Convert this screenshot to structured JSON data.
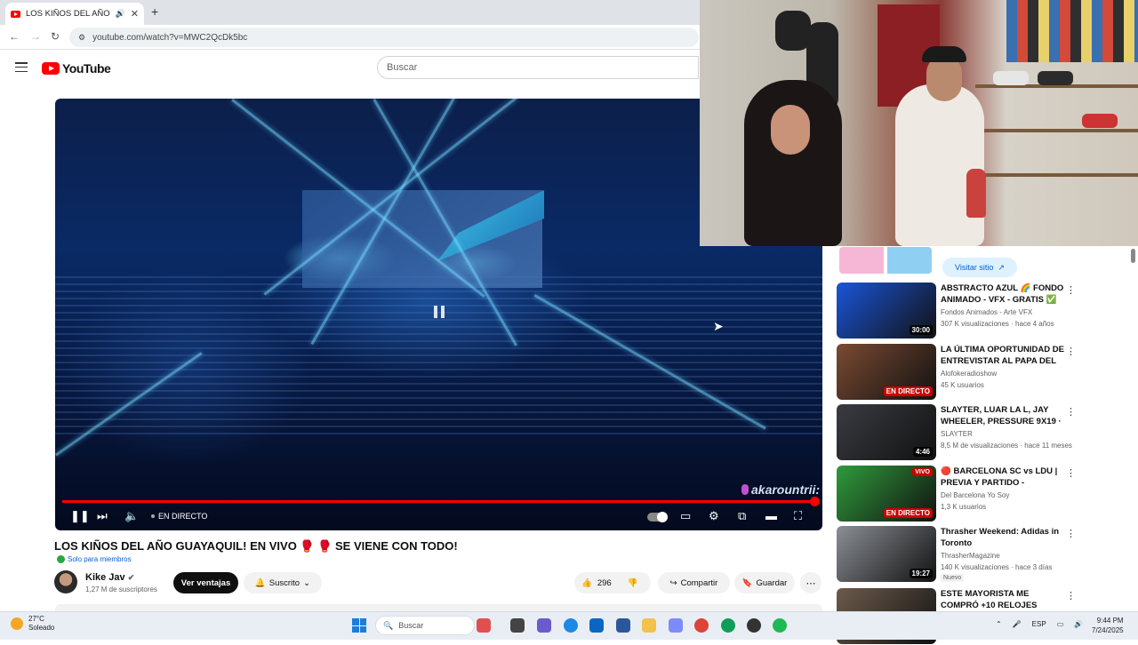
{
  "browser": {
    "tab_title": "LOS KIÑOS DEL AÑO GUAYAQUIL",
    "url": "youtube.com/watch?v=MWC2QcDk5bc"
  },
  "header": {
    "logo_text": "YouTube",
    "search_placeholder": "Buscar"
  },
  "player": {
    "live_label": "EN DIRECTO",
    "watermark_text": "akarountrii:",
    "progress": 1.0
  },
  "video": {
    "title": "LOS KIÑOS DEL AÑO GUAYAQUIL! EN VIVO 🥊 🥊 SE VIENE CON TODO!",
    "members_label": "Solo para miembros",
    "channel_name": "Kike Jav",
    "subscribers": "1,27 M de suscriptores",
    "ventajas_label": "Ver ventajas",
    "subscribed_label": "Suscrito",
    "likes": "296",
    "share_label": "Compartir",
    "save_label": "Guardar"
  },
  "sidebar": {
    "ad_button": "Visitar sitio",
    "recommendations": [
      {
        "title": "ABSTRACTO AZUL 🌈 FONDO ANIMADO - VFX - GRATIS ✅ ...",
        "channel": "Fondos Animados - Arte VFX",
        "meta": "307 K visualizaciones · hace 4 años",
        "badge": "30:00",
        "thumb_color": "#1a55d8"
      },
      {
        "title": "LA ÚLTIMA OPORTUNIDAD DE ENTREVISTAR AL PAPA DEL ...",
        "channel": "Alofokeradioshow",
        "meta": "45 K usuarios",
        "badge": "EN DIRECTO",
        "thumb_color": "#7a4a32"
      },
      {
        "title": "SLAYTER, LUAR LA L, JAY WHEELER, PRESSURE 9X19 · ...",
        "channel": "SLAYTER",
        "meta": "8,5 M de visualizaciones · hace 11 meses",
        "badge": "4:46",
        "thumb_color": "#3a3c42"
      },
      {
        "title": "🔴 BARCELONA SC vs LDU | PREVIA Y PARTIDO - LIGAPRO...",
        "channel": "Del Barcelona Yo Soy",
        "meta": "1,3 K usuarios",
        "badge": "EN DIRECTO",
        "top_badge": "VIVO",
        "thumb_color": "#2f9b3c"
      },
      {
        "title": "Thrasher Weekend: Adidas in Toronto",
        "channel": "ThrasherMagazine",
        "meta": "140 K visualizaciones · hace 3 días",
        "badge": "19:27",
        "new_tag": "Nuevo",
        "thumb_color": "#8b8f95"
      },
      {
        "title": "ESTE MAYORISTA ME COMPRÓ +10 RELOJES",
        "channel": "",
        "meta": "",
        "badge": "",
        "thumb_color": "#6d5b4c"
      }
    ]
  },
  "taskbar": {
    "temperature": "27°C",
    "weather": "Soleado",
    "search_placeholder": "Buscar",
    "language": "ESP",
    "time": "9:44 PM",
    "date": "7/24/2025"
  }
}
